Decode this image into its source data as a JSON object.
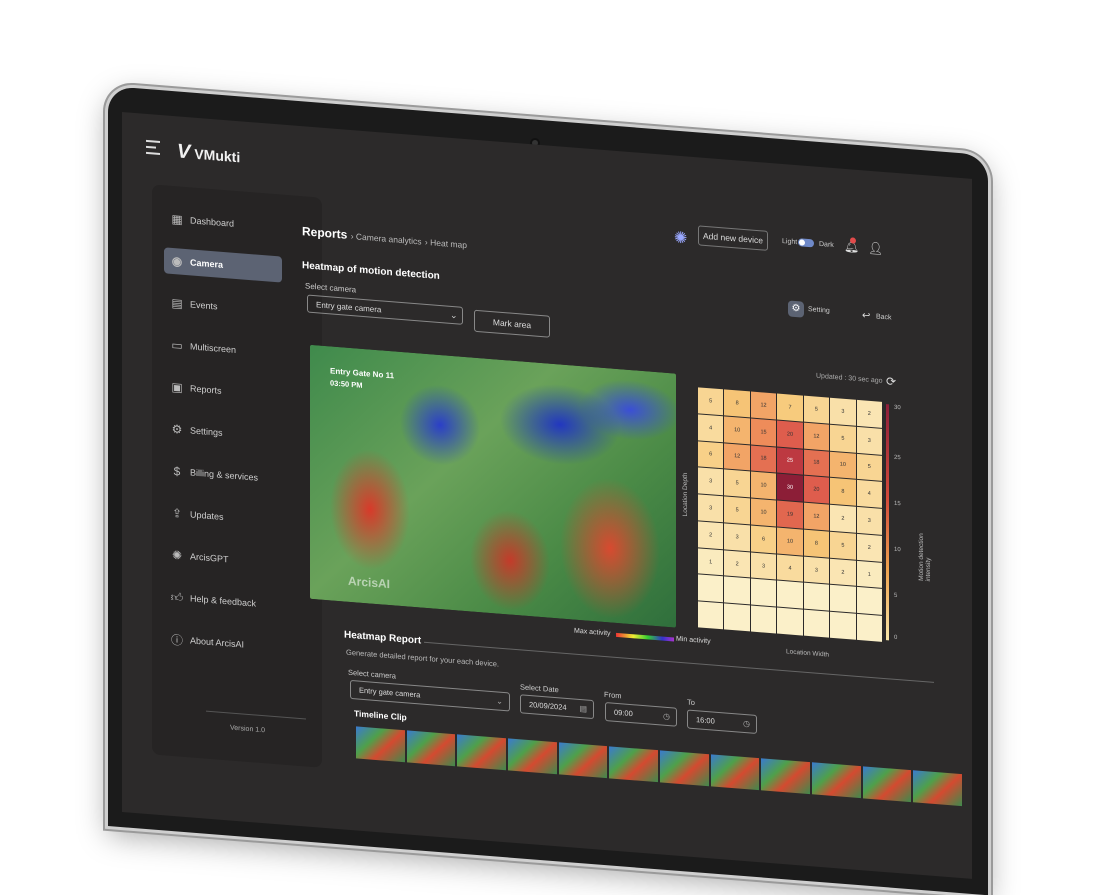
{
  "app": {
    "name": "VMukti"
  },
  "topbar": {
    "add_device_label": "Add new device",
    "light_label": "Light",
    "dark_label": "Dark",
    "icons": [
      "menu-icon",
      "arcis-icon",
      "bell-icon",
      "user-icon"
    ]
  },
  "sidebar": {
    "items": [
      {
        "label": "Dashboard",
        "icon": "dashboard-icon"
      },
      {
        "label": "Camera",
        "icon": "camera-icon",
        "active": true
      },
      {
        "label": "Events",
        "icon": "calendar-icon"
      },
      {
        "label": "Multiscreen",
        "icon": "multiscreen-icon"
      },
      {
        "label": "Reports",
        "icon": "reports-icon"
      },
      {
        "label": "Settings",
        "icon": "gear-icon"
      },
      {
        "label": "Billing & services",
        "icon": "dollar-icon"
      },
      {
        "label": "Updates",
        "icon": "update-icon"
      },
      {
        "label": "ArcisGPT",
        "icon": "arcis-gpt-icon"
      },
      {
        "label": "Help & feedback",
        "icon": "thumbs-up-icon"
      },
      {
        "label": "About ArcisAI",
        "icon": "info-icon"
      }
    ],
    "version": "Version 1.0"
  },
  "breadcrumb": {
    "root": "Reports",
    "mid": "Camera analytics",
    "leaf": "Heat map"
  },
  "heatmap": {
    "title": "Heatmap of motion detection",
    "setting_label": "Setting",
    "back_label": "Back",
    "select_camera_label": "Select camera",
    "selected_camera": "Entry gate camera",
    "mark_area_label": "Mark area",
    "updated": "Updated : 30 sec ago",
    "feed": {
      "camera_name": "Entry Gate No 11",
      "time": "03:50 PM",
      "watermark": "ArcisAI"
    },
    "legend": {
      "max": "Max activity",
      "min": "Min activity"
    },
    "y_axis": "Location Depth",
    "x_axis": "Location Width",
    "scale_label": "Motion detection intensity",
    "scale_ticks": [
      "30",
      "25",
      "15",
      "10",
      "5",
      "0"
    ],
    "grid": [
      [
        "5",
        "8",
        "12",
        "7",
        "5",
        "3",
        "2"
      ],
      [
        "4",
        "10",
        "15",
        "20",
        "12",
        "5",
        "3"
      ],
      [
        "6",
        "12",
        "18",
        "25",
        "18",
        "10",
        "5"
      ],
      [
        "3",
        "5",
        "10",
        "30",
        "20",
        "8",
        "4"
      ],
      [
        "3",
        "5",
        "10",
        "19",
        "12",
        "2",
        "3"
      ],
      [
        "2",
        "3",
        "6",
        "10",
        "8",
        "5",
        "2"
      ],
      [
        "1",
        "2",
        "3",
        "4",
        "3",
        "2",
        "1"
      ],
      [
        "",
        "",
        "",
        "",
        "",
        "",
        ""
      ],
      [
        "",
        "",
        "",
        "",
        "",
        "",
        ""
      ]
    ]
  },
  "report": {
    "title": "Heatmap Report",
    "description": "Generate detailed report for your each device.",
    "select_camera_label": "Select camera",
    "selected_camera": "Entry gate camera",
    "date_label": "Select Date",
    "date_value": "20/09/2024",
    "from_label": "From",
    "from_value": "09:00",
    "to_label": "To",
    "to_value": "16:00",
    "timeline_title": "Timeline Clip",
    "timeline_clips": 12
  },
  "colors": {
    "accent": "#5c6373",
    "background": "#2c2a2a"
  }
}
